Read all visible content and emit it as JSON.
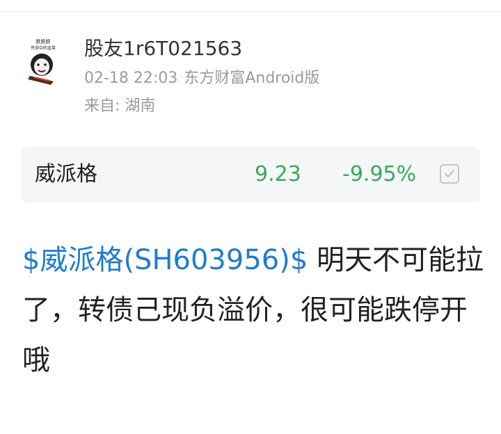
{
  "post": {
    "username": "股友1r6T021563",
    "time": "02-18 22:03",
    "source": "东方财富Android版",
    "location": "来自: 湖南",
    "content_link": "$威派格(SH603956)$",
    "content_text": " 明天不可能拉了，转债己现负溢价，很可能跌停开哦"
  },
  "stock_card": {
    "name": "威派格",
    "price": "9.23",
    "change": "-9.95%",
    "icon": "checkbox-icon"
  },
  "avatar": {
    "caption_1": "跌跌跌",
    "caption_2": "传说中的韭菜"
  },
  "colors": {
    "link": "#1f7bd0",
    "down": "#3aa85a",
    "meta": "#9a9a9a"
  }
}
